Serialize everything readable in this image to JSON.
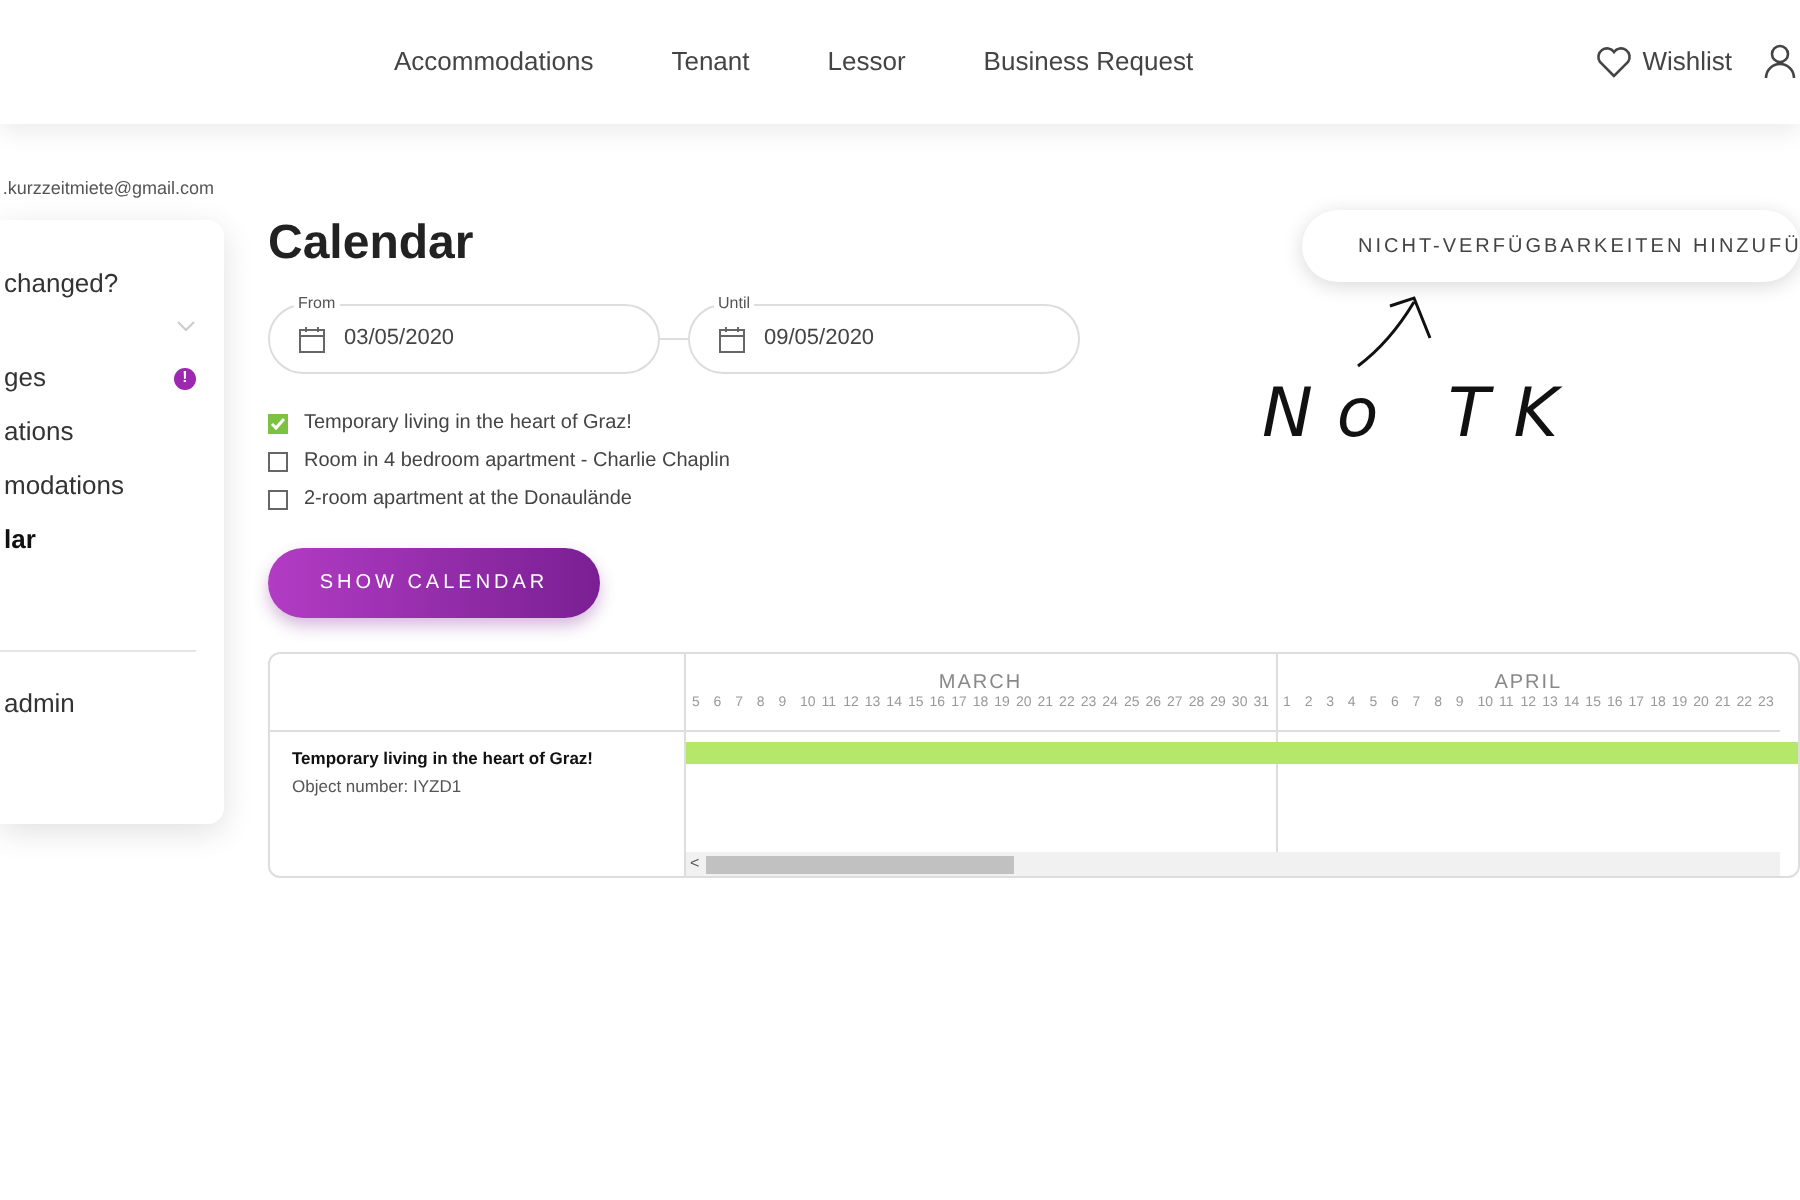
{
  "header": {
    "nav": [
      {
        "label": "Accommodations"
      },
      {
        "label": "Tenant"
      },
      {
        "label": "Lessor"
      },
      {
        "label": "Business Request"
      }
    ],
    "wishlist": "Wishlist"
  },
  "sidebar": {
    "email": ".kurzzeitmiete@gmail.com",
    "question": "changed?",
    "items": [
      {
        "label": "ges",
        "selected": false,
        "alert": "!"
      },
      {
        "label": "ations",
        "selected": false
      },
      {
        "label": "modations",
        "selected": false
      },
      {
        "label": "lar",
        "selected": true
      }
    ],
    "footer_item": "admin"
  },
  "page": {
    "title": "Calendar",
    "add_button": "NICHT-VERFÜGBARKEITEN HINZUFÜ",
    "from": {
      "label": "From",
      "value": "03/05/2020"
    },
    "until": {
      "label": "Until",
      "value": "09/05/2020"
    },
    "objects": [
      {
        "label": "Temporary living in the heart of Graz!",
        "checked": true
      },
      {
        "label": "Room in 4 bedroom apartment - Charlie Chaplin",
        "checked": false
      },
      {
        "label": "2-room apartment at the Donaulände",
        "checked": false
      }
    ],
    "show_button": "SHOW CALENDAR"
  },
  "calendar": {
    "months": [
      {
        "name": "MARCH",
        "days": [
          "5",
          "6",
          "7",
          "8",
          "9",
          "10",
          "11",
          "12",
          "13",
          "14",
          "15",
          "16",
          "17",
          "18",
          "19",
          "20",
          "21",
          "22",
          "23",
          "24",
          "25",
          "26",
          "27",
          "28",
          "29",
          "30",
          "31"
        ]
      },
      {
        "name": "APRIL",
        "days": [
          "1",
          "2",
          "3",
          "4",
          "5",
          "6",
          "7",
          "8",
          "9",
          "10",
          "11",
          "12",
          "13",
          "14",
          "15",
          "16",
          "17",
          "18",
          "19",
          "20",
          "21",
          "22",
          "23"
        ]
      }
    ],
    "rows": [
      {
        "title": "Temporary living in the heart of Graz!",
        "subtitle": "Object number: IYZD1",
        "booked": true
      }
    ],
    "scroll_left": "<"
  },
  "annotation": {
    "text": "No TK"
  }
}
